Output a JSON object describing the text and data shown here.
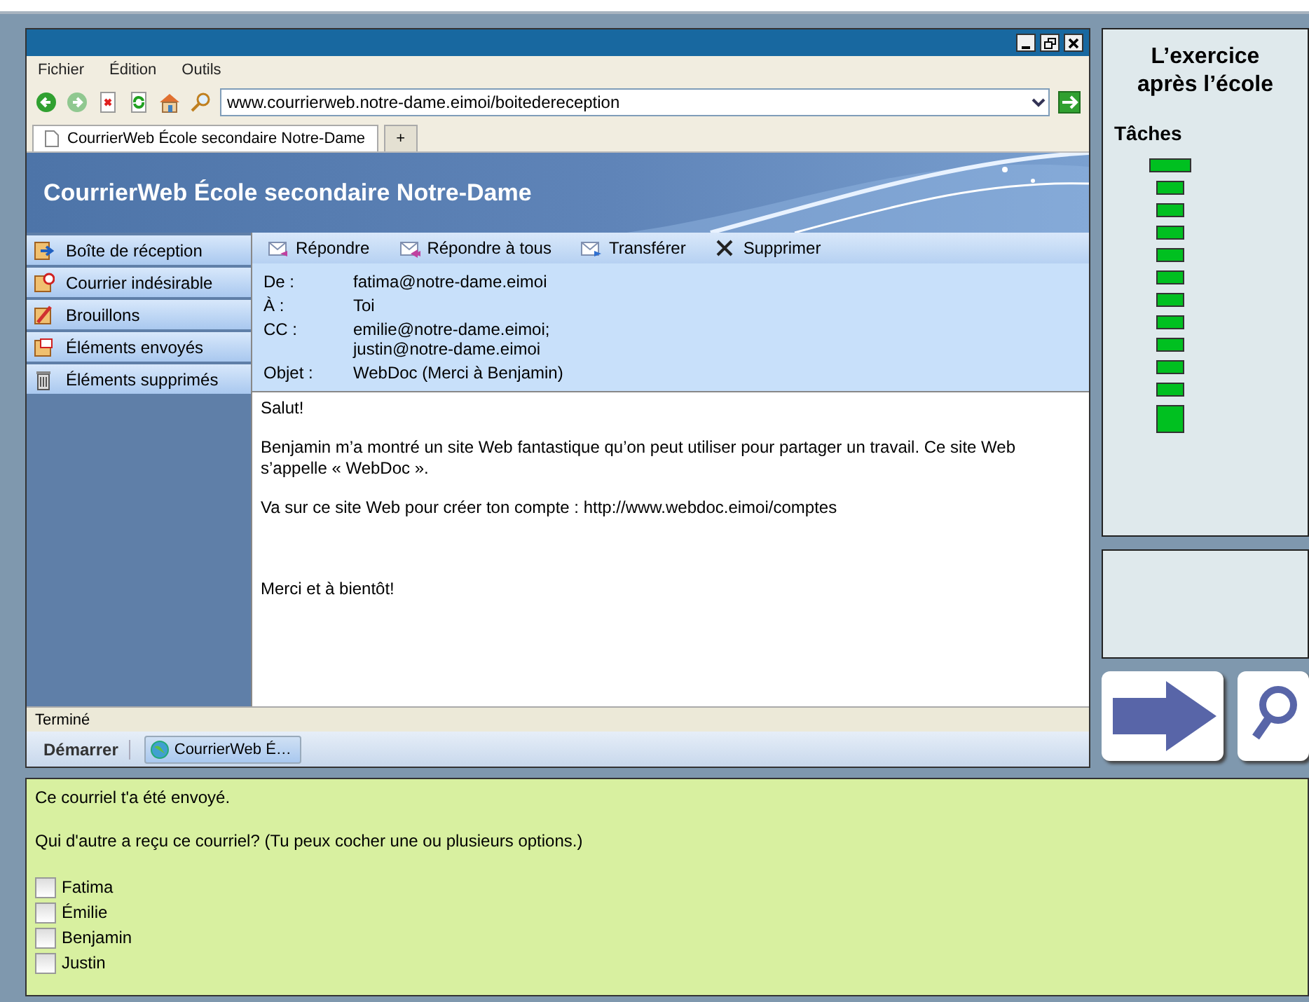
{
  "browser": {
    "menu": [
      "Fichier",
      "Édition",
      "Outils"
    ],
    "address": "www.courrierweb.notre-dame.eimoi/boitedereception",
    "tabs": [
      {
        "label": "CourrierWeb École secondaire Notre-Dame",
        "selected": true
      },
      {
        "label": "+",
        "selected": false
      }
    ],
    "status": "Terminé"
  },
  "mail": {
    "banner": "CourrierWeb École secondaire Notre-Dame",
    "folders": [
      {
        "label": "Boîte de réception",
        "kind": "inbox"
      },
      {
        "label": "Courrier indésirable",
        "kind": "junk"
      },
      {
        "label": "Brouillons",
        "kind": "drafts"
      },
      {
        "label": "Éléments envoyés",
        "kind": "sent"
      },
      {
        "label": "Éléments supprimés",
        "kind": "trash"
      }
    ],
    "actions": [
      {
        "label": "Répondre",
        "kind": "reply"
      },
      {
        "label": "Répondre à tous",
        "kind": "reply-all"
      },
      {
        "label": "Transférer",
        "kind": "forward"
      },
      {
        "label": "Supprimer",
        "kind": "delete"
      }
    ],
    "fields": [
      {
        "label": "De :",
        "lines": [
          "fatima@notre-dame.eimoi"
        ]
      },
      {
        "label": "À :",
        "lines": [
          "Toi"
        ]
      },
      {
        "label": "CC :",
        "lines": [
          "emilie@notre-dame.eimoi;",
          "justin@notre-dame.eimoi"
        ]
      },
      {
        "label": "Objet :",
        "lines": [
          "WebDoc (Merci à Benjamin)"
        ]
      }
    ],
    "body": [
      "Salut!",
      "Benjamin m’a montré un site Web fantastique qu’on peut utiliser pour partager un travail. Ce site Web s’appelle « WebDoc ».",
      "Va sur ce site Web pour créer ton compte : http://www.webdoc.eimoi/comptes",
      "Merci et à bientôt!"
    ]
  },
  "taskbar": {
    "start": "Démarrer",
    "items": [
      "CourrierWeb É…"
    ]
  },
  "side_panel": {
    "title": [
      "L’exercice",
      "après l’école"
    ],
    "tasks_heading": "Tâches",
    "tasks": [
      {
        "kind": "current"
      },
      {
        "kind": "task"
      },
      {
        "kind": "task"
      },
      {
        "kind": "task"
      },
      {
        "kind": "task"
      },
      {
        "kind": "task"
      },
      {
        "kind": "task"
      },
      {
        "kind": "task"
      },
      {
        "kind": "task"
      },
      {
        "kind": "task"
      },
      {
        "kind": "task"
      },
      {
        "kind": "final"
      }
    ]
  },
  "question": {
    "intro": "Ce courriel t'a été envoyé.",
    "prompt": "Qui d'autre a reçu ce courriel? (Tu peux cocher une ou plusieurs options.)",
    "options": [
      {
        "label": "Fatima",
        "checked": false
      },
      {
        "label": "Émilie",
        "checked": false
      },
      {
        "label": "Benjamin",
        "checked": false
      },
      {
        "label": "Justin",
        "checked": false
      }
    ]
  }
}
